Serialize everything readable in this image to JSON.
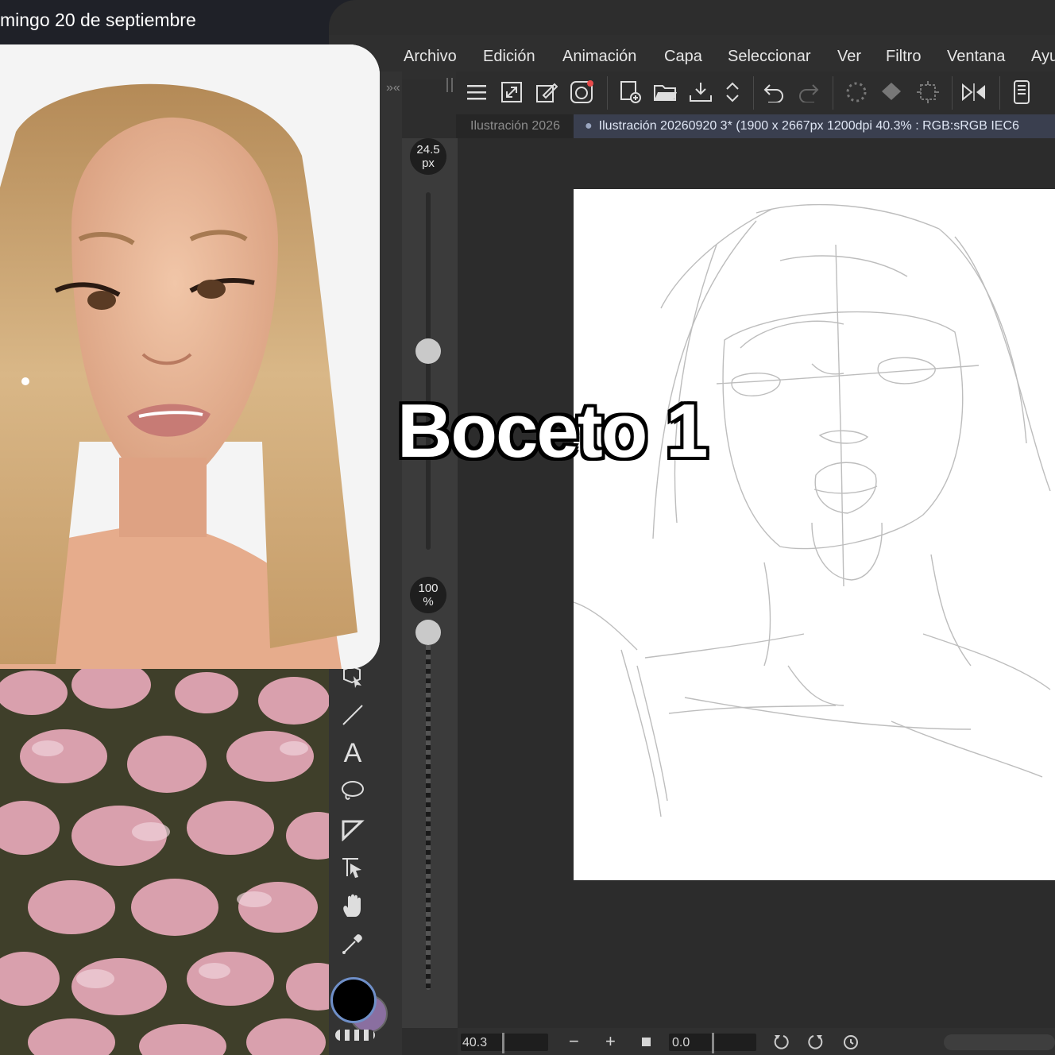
{
  "status": {
    "date": "mingo 20 de septiembre"
  },
  "menu": [
    "Archivo",
    "Edición",
    "Animación",
    "Capa",
    "Seleccionar",
    "Ver",
    "Filtro",
    "Ventana",
    "Ayu"
  ],
  "document_tabs": {
    "inactive": "Ilustración 2026",
    "active": "Ilustración 20260920 3* (1900 x 2667px 1200dpi 40.3% : RGB:sRGB IEC6"
  },
  "brush": {
    "size_value": "24.5",
    "size_unit": "px",
    "opacity_value": "100",
    "opacity_unit": "%"
  },
  "bottom_bar": {
    "zoom": "40.3",
    "minus": "−",
    "plus": "+",
    "rotation": "0.0"
  },
  "overlay_title": "Boceto 1",
  "tools": [
    "transform-icon",
    "line-icon",
    "text-icon",
    "lasso-icon",
    "fill-icon",
    "move-layer-icon",
    "hand-icon",
    "eyedropper-icon"
  ],
  "colors": {
    "main": "#000000",
    "sub": "#8a6fa0",
    "accent_tab": "#3a3f4f"
  }
}
